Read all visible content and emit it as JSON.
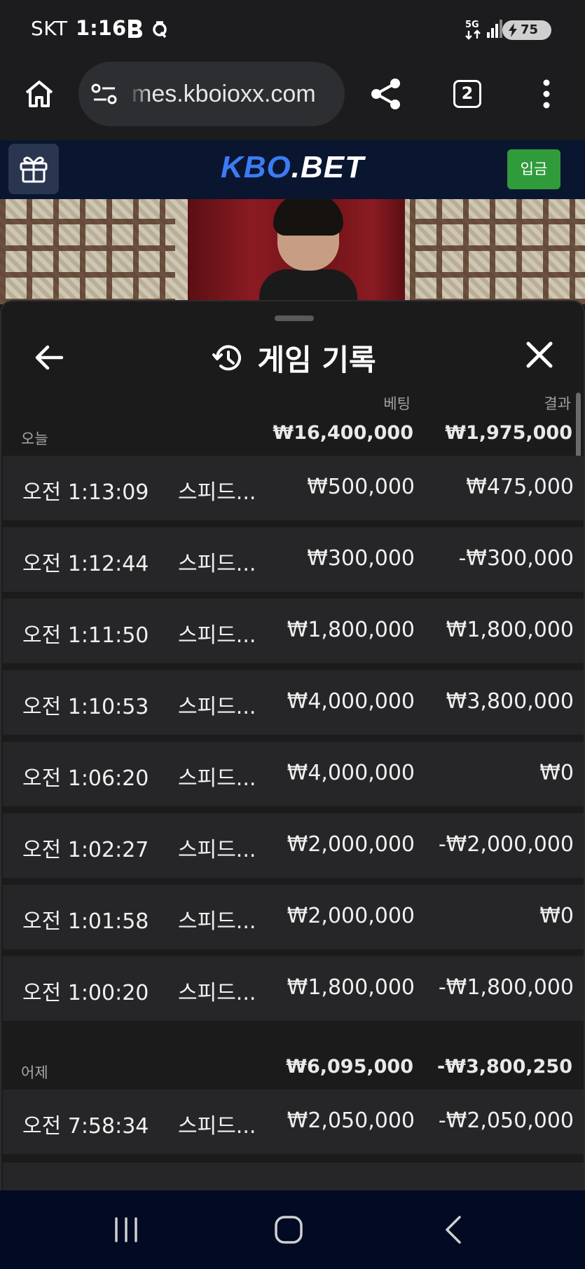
{
  "status_bar": {
    "carrier": "SKT",
    "time": "1:16",
    "network": "5G",
    "battery": "75"
  },
  "browser": {
    "url": "mes.kboioxx.com",
    "tab_count": "2",
    "icons": [
      "home-icon",
      "site-settings-icon",
      "share-icon",
      "more-icon"
    ]
  },
  "site": {
    "logo_kbo": "KBO",
    "logo_bet": ".BET",
    "deposit_label": "입금",
    "brand_color": "#3b7cf5",
    "deposit_color": "#2f9b3b"
  },
  "panel": {
    "title": "게임 기록",
    "col_bet": "베팅",
    "col_result": "결과"
  },
  "groups": [
    {
      "label": "오늘",
      "total_bet": "₩16,400,000",
      "total_result": "₩1,975,000",
      "rows": [
        {
          "time": "오전 1:13:09",
          "game": "스피드...",
          "bet": "₩500,000",
          "result": "₩475,000"
        },
        {
          "time": "오전 1:12:44",
          "game": "스피드...",
          "bet": "₩300,000",
          "result": "-₩300,000"
        },
        {
          "time": "오전 1:11:50",
          "game": "스피드...",
          "bet": "₩1,800,000",
          "result": "₩1,800,000"
        },
        {
          "time": "오전 1:10:53",
          "game": "스피드...",
          "bet": "₩4,000,000",
          "result": "₩3,800,000"
        },
        {
          "time": "오전 1:06:20",
          "game": "스피드...",
          "bet": "₩4,000,000",
          "result": "₩0"
        },
        {
          "time": "오전 1:02:27",
          "game": "스피드...",
          "bet": "₩2,000,000",
          "result": "-₩2,000,000"
        },
        {
          "time": "오전 1:01:58",
          "game": "스피드...",
          "bet": "₩2,000,000",
          "result": "₩0"
        },
        {
          "time": "오전 1:00:20",
          "game": "스피드...",
          "bet": "₩1,800,000",
          "result": "-₩1,800,000"
        }
      ]
    },
    {
      "label": "어제",
      "total_bet": "₩6,095,000",
      "total_result": "-₩3,800,250",
      "rows": [
        {
          "time": "오전 7:58:34",
          "game": "스피드...",
          "bet": "₩2,050,000",
          "result": "-₩2,050,000"
        }
      ]
    }
  ]
}
